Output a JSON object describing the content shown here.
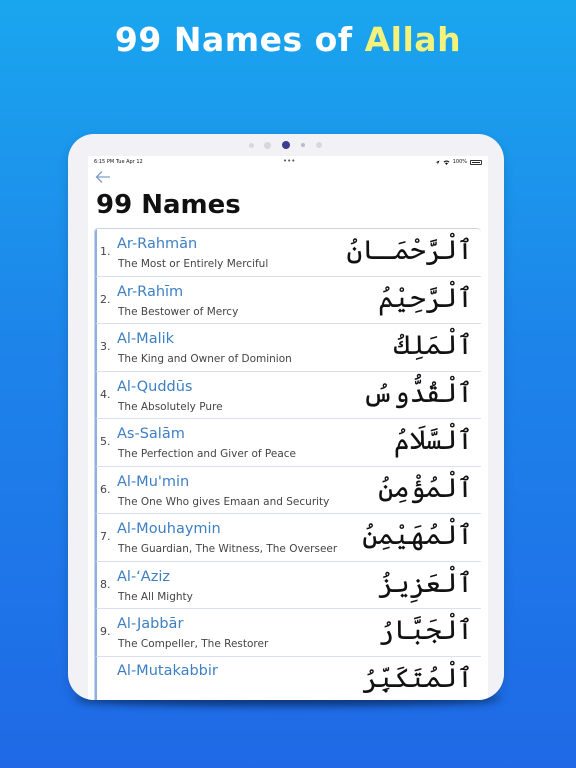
{
  "headline": {
    "prefix": "99 Names of ",
    "accent": "Allah"
  },
  "status_bar": {
    "time": "6:15 PM",
    "date": "Tue Apr 12",
    "multitask": "•••",
    "battery": "100%"
  },
  "nav": {
    "back_icon": "back-arrow-icon"
  },
  "page": {
    "title": "99 Names"
  },
  "names": [
    {
      "num": "1.",
      "name": "Ar-Rahmān",
      "meaning": "The Most or Entirely Merciful",
      "arabic": "ٱلْرَّحْمَـانُ"
    },
    {
      "num": "2.",
      "name": "Ar-Rahīm",
      "meaning": "The Bestower of Mercy",
      "arabic": "ٱلْرَّحِيْمُ"
    },
    {
      "num": "3.",
      "name": "Al-Malik",
      "meaning": "The King and Owner of Dominion",
      "arabic": "ٱلْمَلِكُ"
    },
    {
      "num": "4.",
      "name": "Al-Quddūs",
      "meaning": "The Absolutely Pure",
      "arabic": "ٱلْقُدُّوسُ"
    },
    {
      "num": "5.",
      "name": "As-Salām",
      "meaning": "The Perfection and Giver of Peace",
      "arabic": "ٱلْسَّلَامُ"
    },
    {
      "num": "6.",
      "name": "Al-Mu'min",
      "meaning": "The One Who gives Emaan and Security",
      "arabic": "ٱلْمُؤْمِنُ"
    },
    {
      "num": "7.",
      "name": "Al-Mouhaymin",
      "meaning": "The Guardian, The Witness, The Overseer",
      "arabic": "ٱلْمُهَيْمِنُ"
    },
    {
      "num": "8.",
      "name": "Al-‘Aziz",
      "meaning": "The All Mighty",
      "arabic": "ٱلْعَزِيزُ"
    },
    {
      "num": "9.",
      "name": "Al-Jabbār",
      "meaning": "The Compeller, The Restorer",
      "arabic": "ٱلْجَبَّارُ"
    },
    {
      "num": "",
      "name": "Al-Mutakabbir",
      "meaning": "",
      "arabic": "ٱلْمُتَكَبِّرُ"
    }
  ],
  "colors": {
    "background_top": "#1aa6ee",
    "background_bottom": "#1f69e6",
    "accent": "#f4f27a",
    "name_blue": "#3d7fc4"
  }
}
